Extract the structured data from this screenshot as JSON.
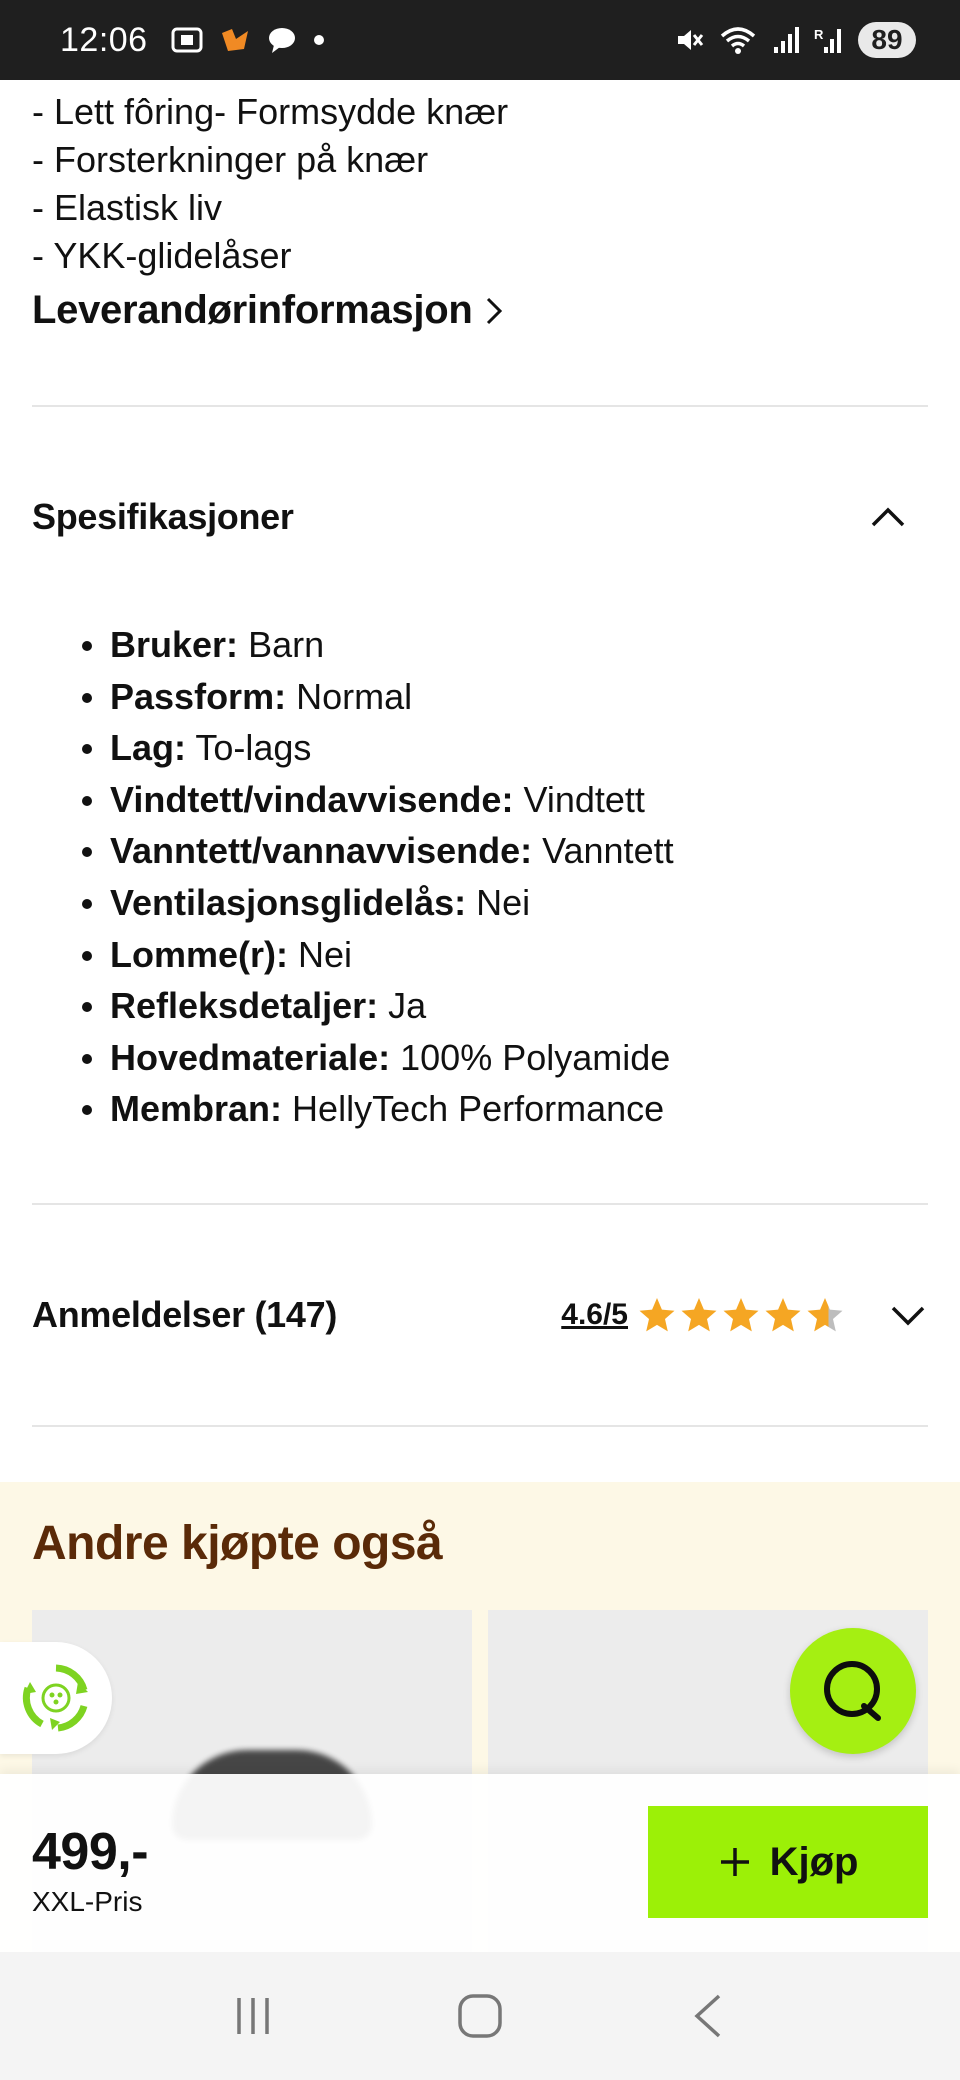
{
  "status_bar": {
    "time": "12:06",
    "battery": "89",
    "icons": [
      "screenshot-icon",
      "app-icon",
      "chat-bubble-icon",
      "dot-icon",
      "mute-icon",
      "wifi-icon",
      "signal-icon",
      "signal-r-icon"
    ]
  },
  "description": {
    "lines": [
      "- Lett fôring- Formsydde knær",
      "- Forsterkninger på knær",
      "- Elastisk liv",
      "- YKK-glidelåser"
    ],
    "supplier_link": "Leverandørinformasjon"
  },
  "specifications": {
    "title": "Spesifikasjoner",
    "items": [
      {
        "key": "Bruker:",
        "value": "Barn"
      },
      {
        "key": "Passform:",
        "value": "Normal"
      },
      {
        "key": "Lag:",
        "value": "To-lags"
      },
      {
        "key": "Vindtett/vindavvisende:",
        "value": "Vindtett"
      },
      {
        "key": "Vanntett/vannavvisende:",
        "value": "Vanntett"
      },
      {
        "key": "Ventilasjonsglidelås:",
        "value": "Nei"
      },
      {
        "key": "Lomme(r):",
        "value": "Nei"
      },
      {
        "key": "Refleksdetaljer:",
        "value": "Ja"
      },
      {
        "key": "Hovedmateriale:",
        "value": "100% Polyamide"
      },
      {
        "key": "Membran:",
        "value": "HellyTech Performance"
      }
    ]
  },
  "reviews": {
    "title": "Anmeldelser (147)",
    "rating_text": "4.6/5",
    "rating": 4.6,
    "max": 5,
    "star_color": "#f5a623"
  },
  "recommendations": {
    "title": "Andre kjøpte også"
  },
  "buy_bar": {
    "price": "499,-",
    "price_label": "XXL-Pris",
    "buy_label": "Kjøp",
    "accent": "#9cf007"
  }
}
